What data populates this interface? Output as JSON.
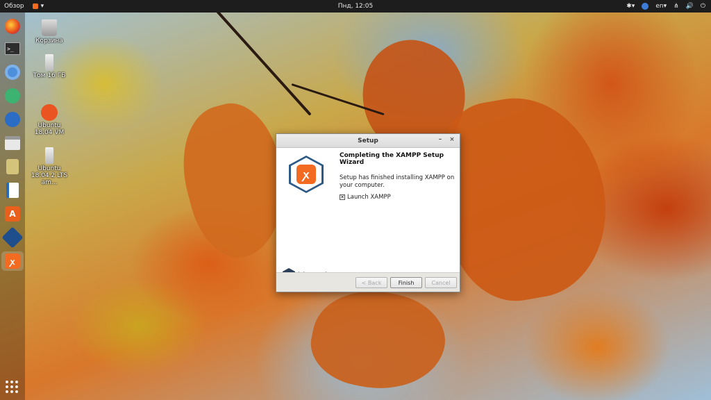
{
  "topbar": {
    "overview": "Обзор",
    "clock": "Пнд, 12:05",
    "language": "en"
  },
  "desktop": {
    "icons": [
      {
        "label": "Корзина"
      },
      {
        "label": "Том 16 ГБ"
      },
      {
        "label": "Ubuntu 18.04 VM"
      },
      {
        "label": "Ubuntu 18.04.2 LTS am..."
      }
    ]
  },
  "dock": {
    "items": [
      "firefox",
      "terminal",
      "chromium",
      "atom",
      "thunderbird",
      "files",
      "rhythmbox",
      "libreoffice-writer",
      "ubuntu-software",
      "virtualbox",
      "xampp"
    ]
  },
  "dialog": {
    "title": "Setup",
    "minimize_glyph": "–",
    "close_glyph": "×",
    "heading": "Completing the XAMPP Setup Wizard",
    "body": "Setup has finished installing XAMPP on your computer.",
    "checkbox_mark": "✕",
    "launch_label": "Launch XAMPP",
    "launch_checked": true,
    "brand": "bitnami",
    "buttons": {
      "back": "< Back",
      "finish": "Finish",
      "cancel": "Cancel"
    }
  },
  "colors": {
    "xampp_orange": "#f26b21",
    "bitnami_navy": "#2b3e57",
    "topbar": "#1d1d1d"
  }
}
